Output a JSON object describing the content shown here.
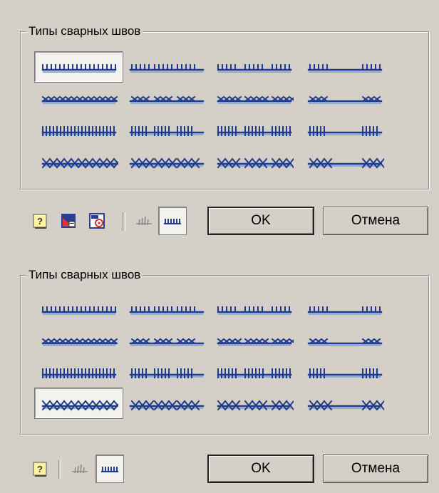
{
  "top_panel": {
    "group_title": "Типы сварных швов",
    "selected_index": 0,
    "toolbar_icons": [
      "help-icon",
      "drawing-sheet-icon",
      "gost-stamp-icon",
      "weld-mark-icon",
      "continuous-weld-icon"
    ],
    "pressed_tool": "continuous-weld-icon",
    "ok_label": "OK",
    "cancel_label": "Отмена"
  },
  "bottom_panel": {
    "group_title": "Типы сварных швов",
    "selected_index": 12,
    "toolbar_icons": [
      "help-icon",
      "weld-mark-icon",
      "continuous-weld-icon"
    ],
    "pressed_tool": "continuous-weld-icon",
    "ok_label": "OK",
    "cancel_label": "Отмена"
  },
  "weld_types": [
    {
      "id": "weld-ticks-continuous"
    },
    {
      "id": "weld-ticks-chain"
    },
    {
      "id": "weld-ticks-staggered"
    },
    {
      "id": "weld-ticks-intermittent"
    },
    {
      "id": "weld-cross-continuous"
    },
    {
      "id": "weld-cross-chain"
    },
    {
      "id": "weld-cross-staggered"
    },
    {
      "id": "weld-cross-intermittent"
    },
    {
      "id": "weld-hash-continuous"
    },
    {
      "id": "weld-hash-chain"
    },
    {
      "id": "weld-hash-staggered"
    },
    {
      "id": "weld-hash-intermittent"
    },
    {
      "id": "weld-x-continuous"
    },
    {
      "id": "weld-x-chain"
    },
    {
      "id": "weld-x-staggered"
    },
    {
      "id": "weld-x-intermittent"
    }
  ],
  "colors": {
    "weld_stroke": "#1f3c8c",
    "weld_shadow": "#8fa8d8",
    "dialog_bg": "#d4d0c8"
  }
}
